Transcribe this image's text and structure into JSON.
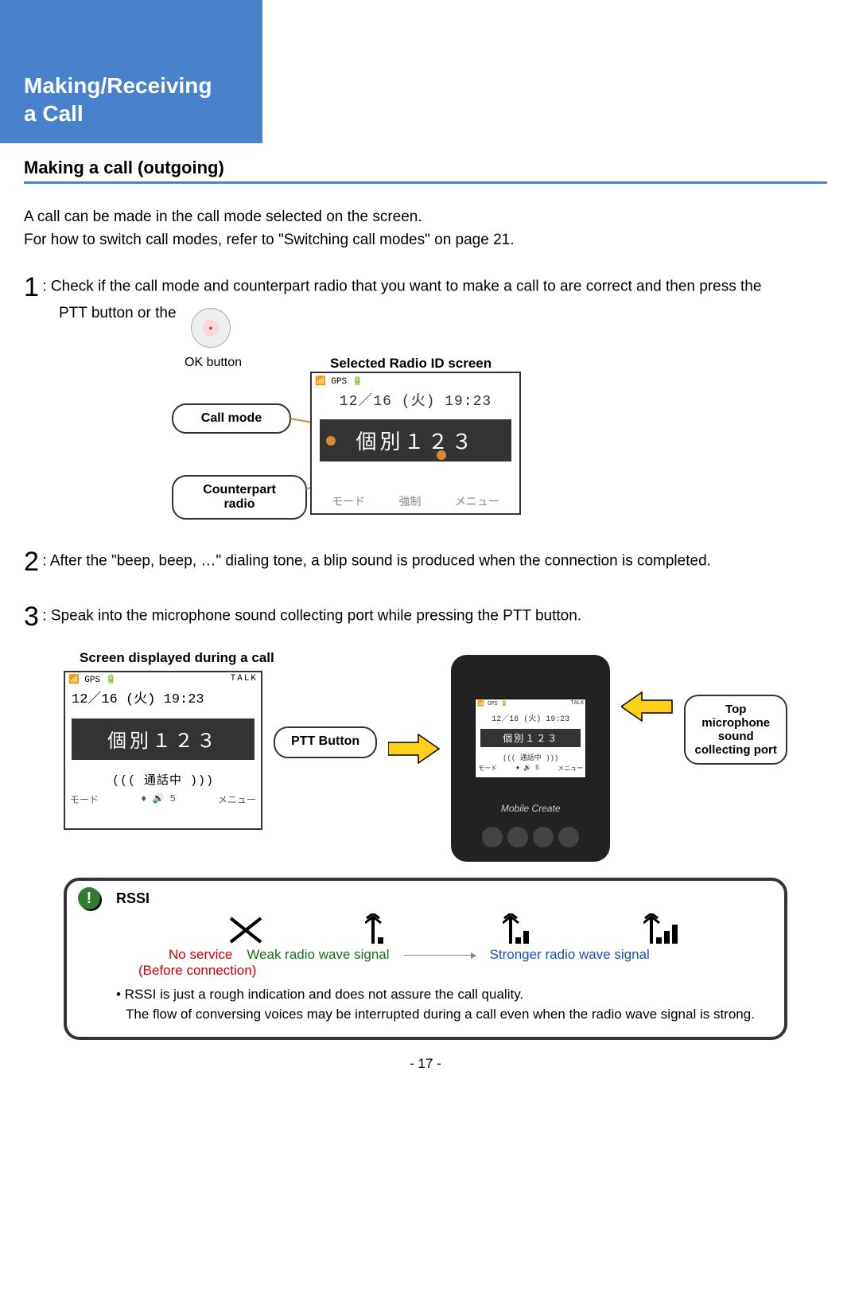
{
  "header": {
    "line1": "Making/Receiving",
    "line2": "a Call"
  },
  "section_title": "Making a call (outgoing)",
  "intro": {
    "line1": "A call can be made in the call mode selected on the screen.",
    "line2": "For how to switch call modes, refer to \"Switching call modes\" on page 21."
  },
  "steps": {
    "s1_num": "1",
    "s1_txt": ": Check if the call mode and counterpart radio that you want to make a call to are correct and then press the",
    "s1_txt_2": "PTT button or the",
    "s2_num": "2",
    "s2_txt": ": After the \"beep, beep, …\" dialing tone, a blip sound is produced when the connection is completed.",
    "s3_num": "3",
    "s3_txt": ": Speak into the microphone sound collecting port while pressing the PTT button."
  },
  "diagram1": {
    "ok_button_label": "OK button",
    "screen_label": "Selected Radio ID screen",
    "call_mode_label": "Call mode",
    "counterpart_label": "Counterpart radio",
    "screen": {
      "status": "📶 GPS   🔋",
      "datetime": "12／16 (火) 19:23",
      "id_text": "個別１２３",
      "bottom_left": "モード",
      "bottom_mid": "強制",
      "bottom_right": "メニュー"
    }
  },
  "diagram2": {
    "title": "Screen displayed during a call",
    "ptt_label": "PTT Button",
    "top_port_label": "Top microphone sound collecting port",
    "screen": {
      "status_left": "📶 GPS  🔋",
      "talk": "TALK",
      "datetime": "12／16 (火) 19:23",
      "id_text": "個別１２３",
      "conversing": "((( 通話中 )))",
      "bl": "モード",
      "bm": "♦ 🔊   5",
      "br": "メニュー"
    },
    "device_brand": "Mobile Create"
  },
  "rssi": {
    "title": "RSSI",
    "no_service": "No service",
    "before_connection": "(Before connection)",
    "weak": "Weak radio wave signal",
    "strong": "Stronger radio wave signal",
    "note_bullet": "• RSSI is just a rough indication and does not assure the call quality.",
    "note_body": "The flow of conversing voices may be interrupted during a call even when the radio wave signal is strong."
  },
  "page_number": "- 17 -"
}
